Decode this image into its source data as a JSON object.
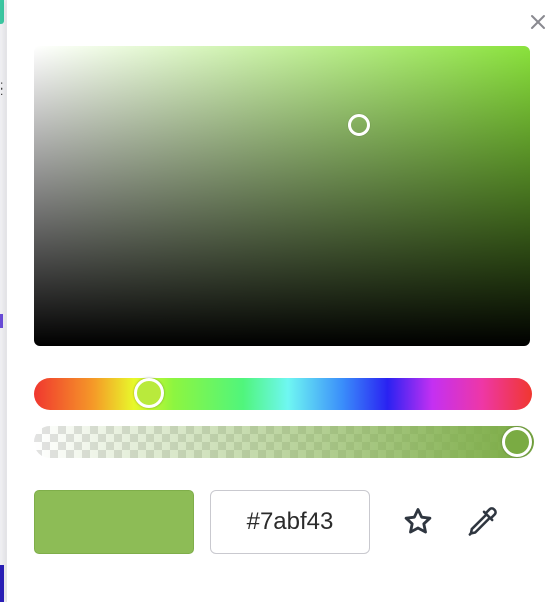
{
  "picker": {
    "hex_value": "#7abf43",
    "selected_color": "#8dbc56",
    "hue_color": "#b9ea3c",
    "alpha": 1.0,
    "close_icon": "close-icon",
    "favorite_icon": "star-icon",
    "eyedropper_icon": "eyedropper-icon"
  }
}
